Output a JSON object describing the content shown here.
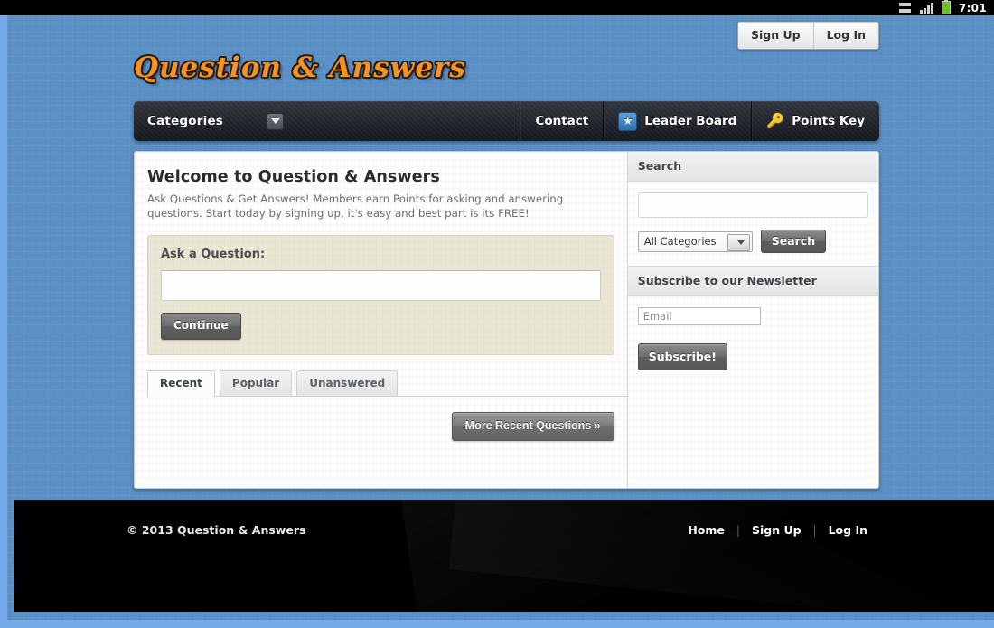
{
  "statusbar": {
    "network_icon": "network-data-icon",
    "signal_icon": "signal-bars-icon",
    "battery_icon": "battery-icon",
    "time": "7:01"
  },
  "auth": {
    "sign_up": "Sign Up",
    "log_in": "Log In"
  },
  "logo": {
    "text": "Question & Answers"
  },
  "nav": {
    "categories_label": "Categories",
    "categories_arrow_icon": "chevron-down-icon",
    "items": [
      {
        "label": "Contact",
        "icon": null
      },
      {
        "label": "Leader Board",
        "icon": "star-icon"
      },
      {
        "label": "Points Key",
        "icon": "key-icon"
      }
    ]
  },
  "content": {
    "heading": "Welcome to Question & Answers",
    "intro": "Ask Questions & Get Answers! Members earn Points for asking and answering questions. Start today by signing up, it's easy and best part is its FREE!",
    "ask": {
      "label": "Ask a Question:",
      "input_value": "",
      "input_placeholder": "",
      "continue_label": "Continue"
    },
    "tabs": [
      {
        "label": "Recent",
        "active": true
      },
      {
        "label": "Popular",
        "active": false
      },
      {
        "label": "Unanswered",
        "active": false
      }
    ],
    "more_button": "More Recent Questions »"
  },
  "sidebar": {
    "search": {
      "heading": "Search",
      "input_value": "",
      "input_placeholder": "",
      "category_selected": "All Categories",
      "category_arrow_icon": "chevron-down-icon",
      "button_label": "Search"
    },
    "newsletter": {
      "heading": "Subscribe to our Newsletter",
      "email_value": "",
      "email_placeholder": "Email",
      "button_label": "Subscribe!"
    }
  },
  "footer": {
    "copyright": "© 2013 Question & Answers",
    "links": [
      "Home",
      "Sign Up",
      "Log In"
    ],
    "divider": "|"
  },
  "colors": {
    "page_background": "#5a8fc4",
    "page_rim": "#74aaea",
    "logo_orange": "#f79124",
    "nav_dark": "#21252b",
    "ask_box_beige": "#e9e6d4",
    "star_icon_blue": "#3d7fb8",
    "key_icon_yellow": "#f2c70d",
    "battery_green": "#6fbf2f",
    "footer_black": "#000000"
  }
}
